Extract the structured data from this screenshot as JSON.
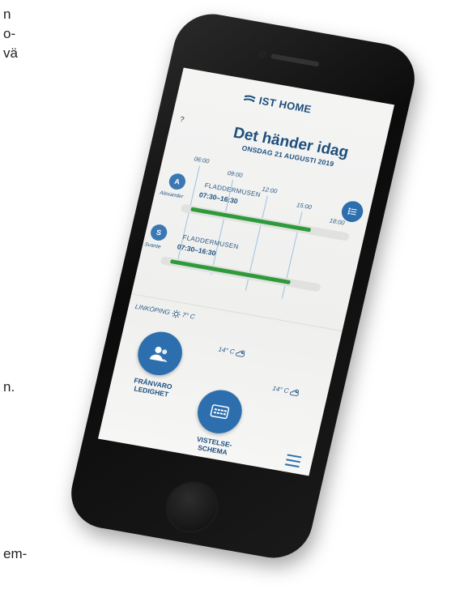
{
  "page_fragments": [
    "n",
    "o-",
    "vä",
    "n.",
    "em-"
  ],
  "app": {
    "logo_text": "IST HOME",
    "help_label": "?",
    "title": "Det händer idag",
    "date": "ONSDAG 21 AUGUSTI 2019"
  },
  "timeline": {
    "ticks": [
      "06:00",
      "09:00",
      "12:00",
      "15:00",
      "18:00"
    ],
    "rows": [
      {
        "initial": "A",
        "name": "Alexander",
        "event": "FLADDERMUSEN",
        "time": "07:30–16:30"
      },
      {
        "initial": "S",
        "name": "Svante",
        "event": "FLADDERMUSEN",
        "time": "07:30–16:30"
      }
    ]
  },
  "weather": {
    "location": "LINKÖPING",
    "now": "7° C",
    "forecast": [
      "14° C",
      "14° C"
    ]
  },
  "actions": {
    "absence_line1": "FRÅNVARO",
    "absence_line2": "LEDIGHET",
    "schedule_line1": "VISTELSE-",
    "schedule_line2": "SCHEMA"
  },
  "colors": {
    "brand": "#1e4f7c",
    "button": "#2d6fae",
    "bar": "#2e9b3a"
  },
  "icons": [
    "logo-mark-icon",
    "list-icon",
    "users-icon",
    "calendar-icon",
    "sun-icon",
    "cloud-sun-icon",
    "menu-icon"
  ]
}
